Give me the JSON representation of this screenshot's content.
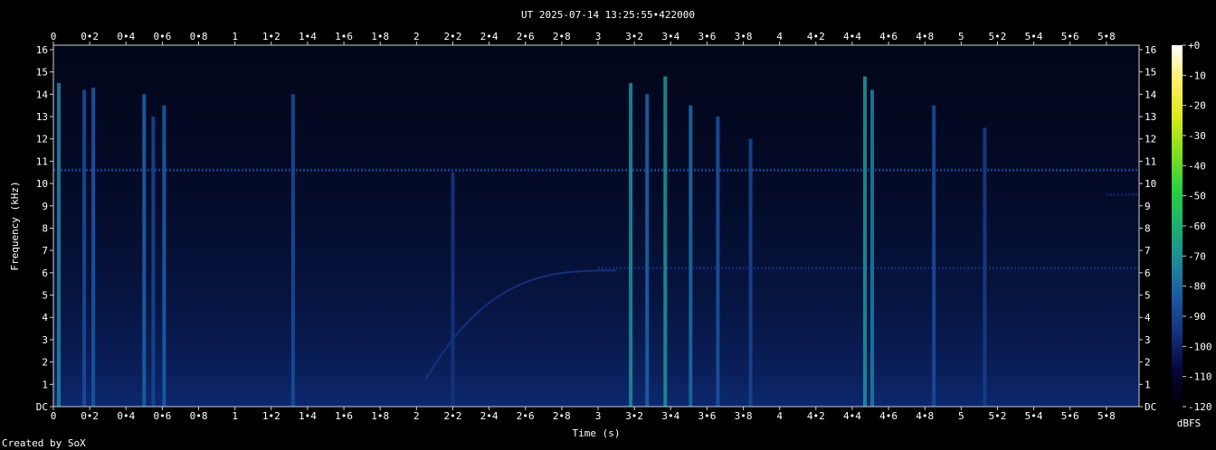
{
  "chart_data": {
    "type": "heatmap",
    "title": "UT 2025-07-14 13:25:55•422000",
    "xlabel": "Time (s)",
    "ylabel": "Frequency (kHz)",
    "xlim": [
      0,
      5.98
    ],
    "ylim": [
      0,
      16.2
    ],
    "x_ticks": [
      "0",
      "0•2",
      "0•4",
      "0•6",
      "0•8",
      "1",
      "1•2",
      "1•4",
      "1•6",
      "1•8",
      "2",
      "2•2",
      "2•4",
      "2•6",
      "2•8",
      "3",
      "3•2",
      "3•4",
      "3•6",
      "3•8",
      "4",
      "4•2",
      "4•4",
      "4•6",
      "4•8",
      "5",
      "5•2",
      "5•4",
      "5•6",
      "5•8"
    ],
    "x_tick_values": [
      0,
      0.2,
      0.4,
      0.6,
      0.8,
      1,
      1.2,
      1.4,
      1.6,
      1.8,
      2,
      2.2,
      2.4,
      2.6,
      2.8,
      3,
      3.2,
      3.4,
      3.6,
      3.8,
      4,
      4.2,
      4.4,
      4.6,
      4.8,
      5,
      5.2,
      5.4,
      5.6,
      5.8
    ],
    "y_ticks": [
      "DC",
      "1",
      "2",
      "3",
      "4",
      "5",
      "6",
      "7",
      "8",
      "9",
      "10",
      "11",
      "12",
      "13",
      "14",
      "15",
      "16"
    ],
    "y_tick_values": [
      0,
      1,
      2,
      3,
      4,
      5,
      6,
      7,
      8,
      9,
      10,
      11,
      12,
      13,
      14,
      15,
      16
    ],
    "colorbar": {
      "label": "dBFS",
      "ticks": [
        "+0",
        "-10",
        "-20",
        "-30",
        "-40",
        "-50",
        "-60",
        "-70",
        "-80",
        "-90",
        "-100",
        "-110",
        "-120"
      ],
      "tick_values": [
        0,
        -10,
        -20,
        -30,
        -40,
        -50,
        -60,
        -70,
        -80,
        -90,
        -100,
        -110,
        -120
      ],
      "range": [
        -120,
        0
      ]
    },
    "noise_floor_dbfs": -100,
    "horizontal_tones": [
      {
        "freq_khz": 10.6,
        "t_start": 0.0,
        "t_end": 5.98,
        "dbfs": -92
      },
      {
        "freq_khz": 6.2,
        "t_start": 3.0,
        "t_end": 5.98,
        "dbfs": -98
      },
      {
        "freq_khz": 9.5,
        "t_start": 5.8,
        "t_end": 5.98,
        "dbfs": -100
      }
    ],
    "chirp": {
      "t_start": 2.05,
      "t_end": 3.1,
      "f_start_khz": 1.2,
      "f_end_khz": 6.1,
      "dbfs": -96
    },
    "transients": [
      {
        "t": 0.03,
        "f_max_khz": 14.5,
        "dbfs": -75
      },
      {
        "t": 0.17,
        "f_max_khz": 14.2,
        "dbfs": -88
      },
      {
        "t": 0.22,
        "f_max_khz": 14.3,
        "dbfs": -85
      },
      {
        "t": 0.5,
        "f_max_khz": 14.0,
        "dbfs": -82
      },
      {
        "t": 0.55,
        "f_max_khz": 13.0,
        "dbfs": -90
      },
      {
        "t": 0.61,
        "f_max_khz": 13.5,
        "dbfs": -83
      },
      {
        "t": 1.32,
        "f_max_khz": 14.0,
        "dbfs": -88
      },
      {
        "t": 2.2,
        "f_max_khz": 10.5,
        "dbfs": -95
      },
      {
        "t": 3.18,
        "f_max_khz": 14.5,
        "dbfs": -72
      },
      {
        "t": 3.27,
        "f_max_khz": 14.0,
        "dbfs": -82
      },
      {
        "t": 3.37,
        "f_max_khz": 14.8,
        "dbfs": -70
      },
      {
        "t": 3.51,
        "f_max_khz": 13.5,
        "dbfs": -80
      },
      {
        "t": 3.66,
        "f_max_khz": 13.0,
        "dbfs": -86
      },
      {
        "t": 3.84,
        "f_max_khz": 12.0,
        "dbfs": -90
      },
      {
        "t": 4.47,
        "f_max_khz": 14.8,
        "dbfs": -70
      },
      {
        "t": 4.51,
        "f_max_khz": 14.2,
        "dbfs": -76
      },
      {
        "t": 4.85,
        "f_max_khz": 13.5,
        "dbfs": -88
      },
      {
        "t": 5.13,
        "f_max_khz": 12.5,
        "dbfs": -92
      }
    ]
  },
  "credit": "Created by SoX"
}
